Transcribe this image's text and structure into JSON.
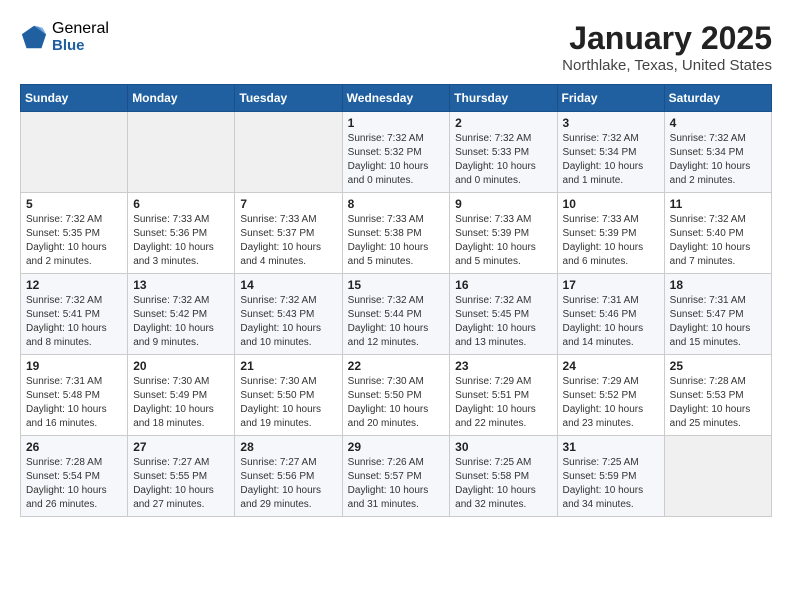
{
  "logo": {
    "general": "General",
    "blue": "Blue"
  },
  "title": "January 2025",
  "subtitle": "Northlake, Texas, United States",
  "headers": [
    "Sunday",
    "Monday",
    "Tuesday",
    "Wednesday",
    "Thursday",
    "Friday",
    "Saturday"
  ],
  "weeks": [
    [
      {
        "day": "",
        "info": ""
      },
      {
        "day": "",
        "info": ""
      },
      {
        "day": "",
        "info": ""
      },
      {
        "day": "1",
        "info": "Sunrise: 7:32 AM\nSunset: 5:32 PM\nDaylight: 10 hours\nand 0 minutes."
      },
      {
        "day": "2",
        "info": "Sunrise: 7:32 AM\nSunset: 5:33 PM\nDaylight: 10 hours\nand 0 minutes."
      },
      {
        "day": "3",
        "info": "Sunrise: 7:32 AM\nSunset: 5:34 PM\nDaylight: 10 hours\nand 1 minute."
      },
      {
        "day": "4",
        "info": "Sunrise: 7:32 AM\nSunset: 5:34 PM\nDaylight: 10 hours\nand 2 minutes."
      }
    ],
    [
      {
        "day": "5",
        "info": "Sunrise: 7:32 AM\nSunset: 5:35 PM\nDaylight: 10 hours\nand 2 minutes."
      },
      {
        "day": "6",
        "info": "Sunrise: 7:33 AM\nSunset: 5:36 PM\nDaylight: 10 hours\nand 3 minutes."
      },
      {
        "day": "7",
        "info": "Sunrise: 7:33 AM\nSunset: 5:37 PM\nDaylight: 10 hours\nand 4 minutes."
      },
      {
        "day": "8",
        "info": "Sunrise: 7:33 AM\nSunset: 5:38 PM\nDaylight: 10 hours\nand 5 minutes."
      },
      {
        "day": "9",
        "info": "Sunrise: 7:33 AM\nSunset: 5:39 PM\nDaylight: 10 hours\nand 5 minutes."
      },
      {
        "day": "10",
        "info": "Sunrise: 7:33 AM\nSunset: 5:39 PM\nDaylight: 10 hours\nand 6 minutes."
      },
      {
        "day": "11",
        "info": "Sunrise: 7:32 AM\nSunset: 5:40 PM\nDaylight: 10 hours\nand 7 minutes."
      }
    ],
    [
      {
        "day": "12",
        "info": "Sunrise: 7:32 AM\nSunset: 5:41 PM\nDaylight: 10 hours\nand 8 minutes."
      },
      {
        "day": "13",
        "info": "Sunrise: 7:32 AM\nSunset: 5:42 PM\nDaylight: 10 hours\nand 9 minutes."
      },
      {
        "day": "14",
        "info": "Sunrise: 7:32 AM\nSunset: 5:43 PM\nDaylight: 10 hours\nand 10 minutes."
      },
      {
        "day": "15",
        "info": "Sunrise: 7:32 AM\nSunset: 5:44 PM\nDaylight: 10 hours\nand 12 minutes."
      },
      {
        "day": "16",
        "info": "Sunrise: 7:32 AM\nSunset: 5:45 PM\nDaylight: 10 hours\nand 13 minutes."
      },
      {
        "day": "17",
        "info": "Sunrise: 7:31 AM\nSunset: 5:46 PM\nDaylight: 10 hours\nand 14 minutes."
      },
      {
        "day": "18",
        "info": "Sunrise: 7:31 AM\nSunset: 5:47 PM\nDaylight: 10 hours\nand 15 minutes."
      }
    ],
    [
      {
        "day": "19",
        "info": "Sunrise: 7:31 AM\nSunset: 5:48 PM\nDaylight: 10 hours\nand 16 minutes."
      },
      {
        "day": "20",
        "info": "Sunrise: 7:30 AM\nSunset: 5:49 PM\nDaylight: 10 hours\nand 18 minutes."
      },
      {
        "day": "21",
        "info": "Sunrise: 7:30 AM\nSunset: 5:50 PM\nDaylight: 10 hours\nand 19 minutes."
      },
      {
        "day": "22",
        "info": "Sunrise: 7:30 AM\nSunset: 5:50 PM\nDaylight: 10 hours\nand 20 minutes."
      },
      {
        "day": "23",
        "info": "Sunrise: 7:29 AM\nSunset: 5:51 PM\nDaylight: 10 hours\nand 22 minutes."
      },
      {
        "day": "24",
        "info": "Sunrise: 7:29 AM\nSunset: 5:52 PM\nDaylight: 10 hours\nand 23 minutes."
      },
      {
        "day": "25",
        "info": "Sunrise: 7:28 AM\nSunset: 5:53 PM\nDaylight: 10 hours\nand 25 minutes."
      }
    ],
    [
      {
        "day": "26",
        "info": "Sunrise: 7:28 AM\nSunset: 5:54 PM\nDaylight: 10 hours\nand 26 minutes."
      },
      {
        "day": "27",
        "info": "Sunrise: 7:27 AM\nSunset: 5:55 PM\nDaylight: 10 hours\nand 27 minutes."
      },
      {
        "day": "28",
        "info": "Sunrise: 7:27 AM\nSunset: 5:56 PM\nDaylight: 10 hours\nand 29 minutes."
      },
      {
        "day": "29",
        "info": "Sunrise: 7:26 AM\nSunset: 5:57 PM\nDaylight: 10 hours\nand 31 minutes."
      },
      {
        "day": "30",
        "info": "Sunrise: 7:25 AM\nSunset: 5:58 PM\nDaylight: 10 hours\nand 32 minutes."
      },
      {
        "day": "31",
        "info": "Sunrise: 7:25 AM\nSunset: 5:59 PM\nDaylight: 10 hours\nand 34 minutes."
      },
      {
        "day": "",
        "info": ""
      }
    ]
  ]
}
